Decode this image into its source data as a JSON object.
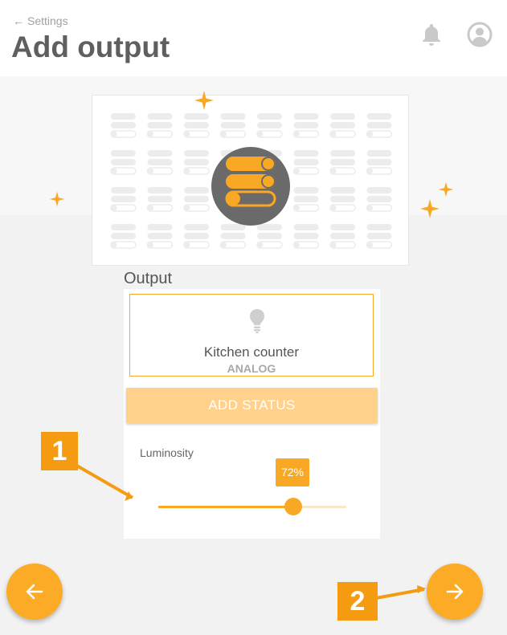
{
  "header": {
    "back_label": "Settings",
    "title": "Add output",
    "icons": [
      "arrow-left-icon",
      "bell-icon",
      "user-icon"
    ]
  },
  "output": {
    "section_label": "Output",
    "device_name": "Kitchen counter",
    "device_type": "ANALOG",
    "add_status_label": "ADD STATUS",
    "luminosity_label": "Luminosity",
    "luminosity_value": "72%",
    "luminosity_fraction": 0.72
  },
  "navigation": {
    "back_icon": "arrow-left-icon",
    "next_icon": "arrow-right-icon"
  },
  "annotations": {
    "callout_1": "1",
    "callout_2": "2"
  },
  "colors": {
    "accent": "#f9a826",
    "accent_light": "#ffd18a",
    "callout": "#f49b12",
    "title_gray": "#5f5f5f"
  }
}
